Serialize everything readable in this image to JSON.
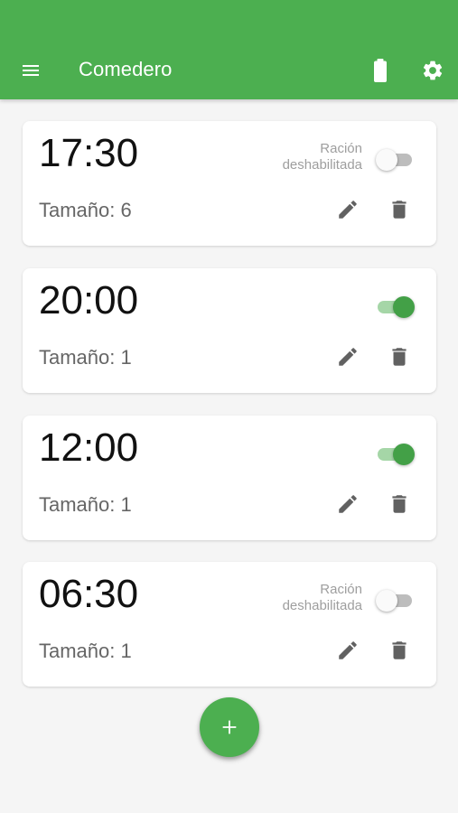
{
  "app_bar": {
    "title": "Comedero",
    "icons": [
      "menu-icon",
      "battery-full-icon",
      "settings-gear-icon"
    ],
    "color": "#4caf50"
  },
  "feedings": [
    {
      "time": "17:30",
      "size_text": "Tamaño: 6",
      "enabled": false,
      "status_line1": "Ración",
      "status_line2": "deshabilitada"
    },
    {
      "time": "20:00",
      "size_text": "Tamaño: 1",
      "enabled": true,
      "status_line1": "",
      "status_line2": ""
    },
    {
      "time": "12:00",
      "size_text": "Tamaño: 1",
      "enabled": true,
      "status_line1": "",
      "status_line2": ""
    },
    {
      "time": "06:30",
      "size_text": "Tamaño: 1",
      "enabled": false,
      "status_line1": "Ración",
      "status_line2": "deshabilitada"
    }
  ],
  "card_icons": [
    "edit-pencil-icon",
    "delete-trash-icon"
  ],
  "fab": {
    "icon": "plus-icon",
    "label": "+"
  },
  "colors": {
    "accent": "#4caf50",
    "switch_on": "#43a047",
    "switch_track_on": "#a5d6a7",
    "switch_off_track": "#bdbdbd",
    "muted_text": "#9e9e9e"
  }
}
